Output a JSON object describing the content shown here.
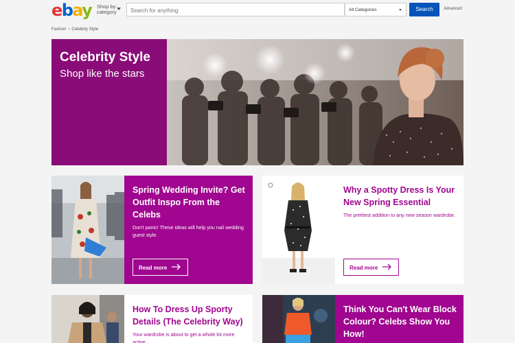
{
  "header": {
    "logo": [
      "e",
      "b",
      "a",
      "y"
    ],
    "shop_by_category": "Shop by category",
    "search_placeholder": "Search for anything",
    "category_select": "All Categories",
    "search_button": "Search",
    "advanced_link": "Advanced"
  },
  "breadcrumb": [
    "Fashion",
    "Celebrity Style"
  ],
  "hero": {
    "title": "Celebrity Style",
    "subtitle": "Shop like the stars"
  },
  "cards": [
    {
      "title": "Spring Wedding Invite? Get Outfit Inspo From the Celebs",
      "description": "Don't panic! These ideas will help you nail wedding guest style.",
      "button": "Read more"
    },
    {
      "title": "Why a Spotty Dress Is Your New Spring Essential",
      "description": "The prettiest addition to any new season wardrobe.",
      "button": "Read more"
    },
    {
      "title": "How To Dress Up Sporty Details (The Celebrity Way)",
      "description": "Your wardrobe is about to get a whole lot more active."
    },
    {
      "title": "Think You Can't Wear Block Colour? Celebs Show You How!"
    }
  ],
  "colors": {
    "brand_magenta": "#a0068f",
    "hero_panel": "#8a0c78",
    "search_button": "#0654ba"
  }
}
